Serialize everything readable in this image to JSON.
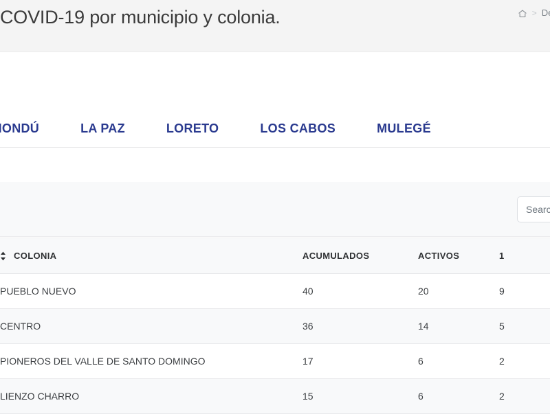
{
  "header": {
    "title": "COVID-19 por municipio y colonia.",
    "breadcrumb": {
      "home_icon": "home-icon",
      "separator": ">",
      "current": "Desglose"
    }
  },
  "tabs": [
    {
      "label": "COMONDÚ"
    },
    {
      "label": "LA PAZ"
    },
    {
      "label": "LORETO"
    },
    {
      "label": "LOS CABOS"
    },
    {
      "label": "MULEGÉ"
    }
  ],
  "toolbar": {
    "search_placeholder": "Search",
    "search_value": ""
  },
  "table": {
    "sort_icon": "sort-ascending-descending-icon",
    "columns": [
      {
        "key": "idx",
        "label": ""
      },
      {
        "key": "colonia",
        "label": "COLONIA"
      },
      {
        "key": "acum",
        "label": "ACUMULADOS"
      },
      {
        "key": "act",
        "label": "ACTIVOS"
      },
      {
        "key": "extra",
        "label": "1"
      }
    ],
    "rows": [
      {
        "idx": "",
        "colonia": "PUEBLO NUEVO",
        "acum": "40",
        "act": "20",
        "extra": "9"
      },
      {
        "idx": "",
        "colonia": "CENTRO",
        "acum": "36",
        "act": "14",
        "extra": "5"
      },
      {
        "idx": "",
        "colonia": "PIONEROS DEL VALLE DE SANTO DOMINGO",
        "acum": "17",
        "act": "6",
        "extra": "2"
      },
      {
        "idx": "",
        "colonia": "LIENZO CHARRO",
        "acum": "15",
        "act": "6",
        "extra": "2"
      }
    ]
  },
  "colors": {
    "tab_blue": "#2a3a8f",
    "header_band": "#f4f4f4",
    "row_stripe": "#f8f9fa",
    "title_text": "#3b3b3b"
  }
}
